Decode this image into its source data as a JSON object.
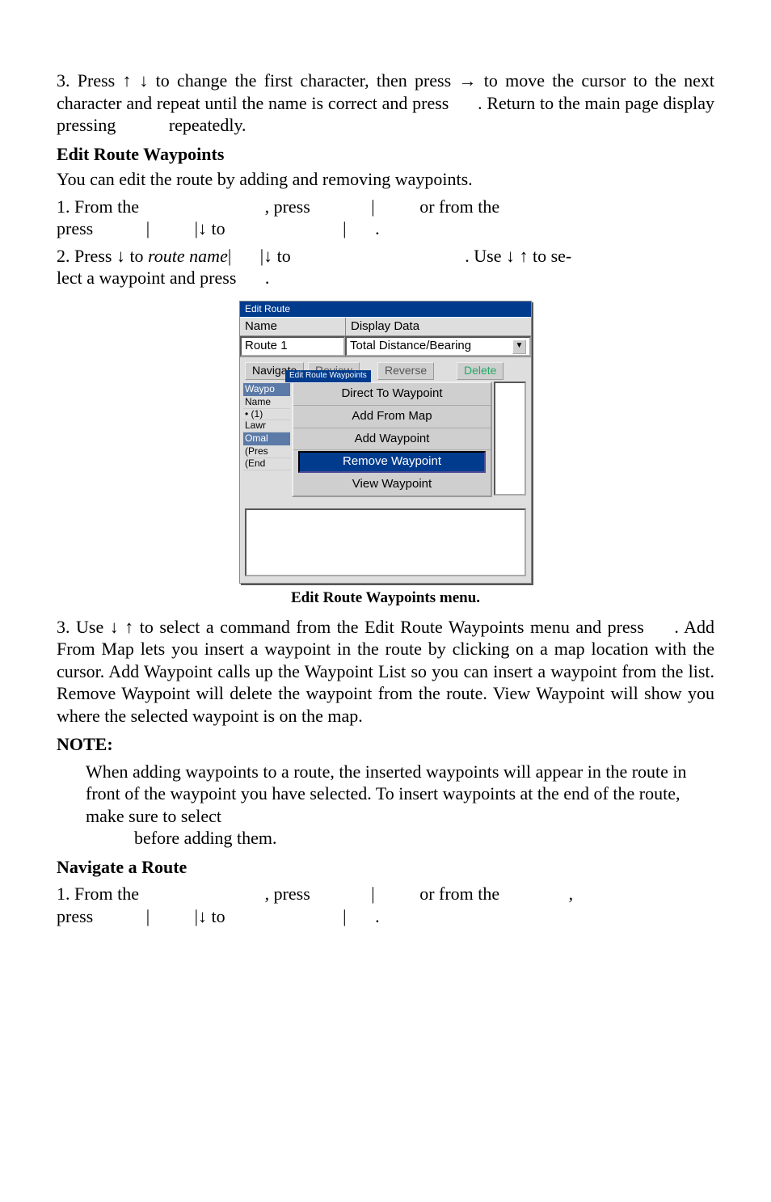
{
  "steps_top": {
    "s3": {
      "part1": "3. Press ",
      "arrows1": "↑ ↓",
      "part2": " to change the first character, then press ",
      "arrow_r": "→",
      "part3": " to move the cursor to the next character and repeat until the name is correct and press",
      "gap1": ". Return to the main page display pressing",
      "gap2": "repeatedly."
    }
  },
  "section1": {
    "title": "Edit Route Waypoints",
    "intro": "You can edit the route by adding and removing waypoints.",
    "step1": {
      "a": "1.  From  the",
      "b": ",  press",
      "c": "|",
      "d": "or  from  the",
      "e": "press",
      "f": "|",
      "g": "|↓ to",
      "h": "|",
      "i": "."
    },
    "step2": {
      "a": "2. Press ↓ to ",
      "italic": "route name",
      "b": "|",
      "c": "|↓ to",
      "d": ". Use ↓ ↑ to se-",
      "e": "lect a waypoint and press",
      "f": "."
    }
  },
  "window": {
    "title": "Edit Route",
    "hdr_l": "Name",
    "hdr_r": "Display Data",
    "val_l": "Route 1",
    "val_r": "Total Distance/Bearing",
    "tabs": {
      "navigate": "Navigate",
      "review": "Review",
      "reverse": "Reverse",
      "delete": "Delete"
    },
    "overlay": "Edit Route Waypoints",
    "left": {
      "waypo": "Waypo",
      "name": "Name",
      "one": "•  (1)",
      "lawr": "Lawr",
      "omal": "Omal",
      "pres": "(Pres",
      "end": "(End"
    },
    "menu": {
      "m1": "Direct To Waypoint",
      "m2": "Add From Map",
      "m3": "Add Waypoint",
      "m4": "Remove Waypoint",
      "m5": "View Waypoint"
    },
    "caption": "Edit Route Waypoints menu."
  },
  "section2": {
    "step3": {
      "a": "3. Use ↓ ↑ to select a command from the Edit Route Waypoints menu and press",
      "b": ". Add From Map lets you insert a waypoint in the route by clicking on a map location with the cursor. Add Waypoint calls up the Waypoint List so you can insert a waypoint from the list. Remove Waypoint will delete the waypoint from the route. View Waypoint will show you where the selected waypoint is on the map."
    },
    "note_label": "NOTE:",
    "note_body": "When adding waypoints to a route, the inserted waypoints will ap­pear in the route in front of the waypoint you have selected. To in­sert waypoints at the end of the route, make sure to select",
    "note_tail": "before adding them."
  },
  "section3": {
    "title": "Navigate a Route",
    "step1": {
      "a": "1.  From  the",
      "b": ",  press",
      "c": "|",
      "d": "or  from  the",
      "e": ",",
      "f": "press",
      "g": "|",
      "h": "|↓ to",
      "i": "|",
      "j": "."
    }
  }
}
